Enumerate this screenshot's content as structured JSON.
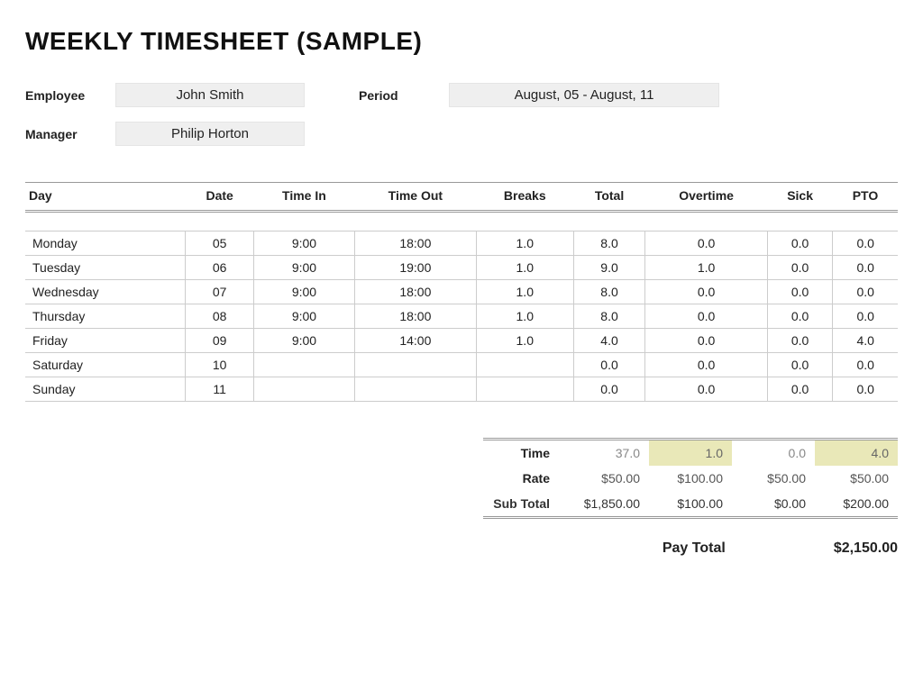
{
  "title": "WEEKLY TIMESHEET (SAMPLE)",
  "meta": {
    "employee_label": "Employee",
    "employee_value": "John Smith",
    "period_label": "Period",
    "period_value": "August, 05 - August, 11",
    "manager_label": "Manager",
    "manager_value": "Philip Horton"
  },
  "columns": {
    "day": "Day",
    "date": "Date",
    "time_in": "Time In",
    "time_out": "Time Out",
    "breaks": "Breaks",
    "total": "Total",
    "overtime": "Overtime",
    "sick": "Sick",
    "pto": "PTO"
  },
  "rows": [
    {
      "day": "Monday",
      "date": "05",
      "in": "9:00",
      "out": "18:00",
      "breaks": "1.0",
      "total": "8.0",
      "ot": "0.0",
      "sick": "0.0",
      "pto": "0.0"
    },
    {
      "day": "Tuesday",
      "date": "06",
      "in": "9:00",
      "out": "19:00",
      "breaks": "1.0",
      "total": "9.0",
      "ot": "1.0",
      "sick": "0.0",
      "pto": "0.0"
    },
    {
      "day": "Wednesday",
      "date": "07",
      "in": "9:00",
      "out": "18:00",
      "breaks": "1.0",
      "total": "8.0",
      "ot": "0.0",
      "sick": "0.0",
      "pto": "0.0"
    },
    {
      "day": "Thursday",
      "date": "08",
      "in": "9:00",
      "out": "18:00",
      "breaks": "1.0",
      "total": "8.0",
      "ot": "0.0",
      "sick": "0.0",
      "pto": "0.0"
    },
    {
      "day": "Friday",
      "date": "09",
      "in": "9:00",
      "out": "14:00",
      "breaks": "1.0",
      "total": "4.0",
      "ot": "0.0",
      "sick": "0.0",
      "pto": "4.0"
    },
    {
      "day": "Saturday",
      "date": "10",
      "in": "",
      "out": "",
      "breaks": "",
      "total": "0.0",
      "ot": "0.0",
      "sick": "0.0",
      "pto": "0.0"
    },
    {
      "day": "Sunday",
      "date": "11",
      "in": "",
      "out": "",
      "breaks": "",
      "total": "0.0",
      "ot": "0.0",
      "sick": "0.0",
      "pto": "0.0"
    }
  ],
  "summary": {
    "labels": {
      "time": "Time",
      "rate": "Rate",
      "sub": "Sub Total",
      "pay": "Pay Total"
    },
    "time": {
      "total": "37.0",
      "ot": "1.0",
      "sick": "0.0",
      "pto": "4.0"
    },
    "rate": {
      "total": "$50.00",
      "ot": "$100.00",
      "sick": "$50.00",
      "pto": "$50.00"
    },
    "sub": {
      "total": "$1,850.00",
      "ot": "$100.00",
      "sick": "$0.00",
      "pto": "$200.00"
    },
    "pay_total": "$2,150.00"
  }
}
